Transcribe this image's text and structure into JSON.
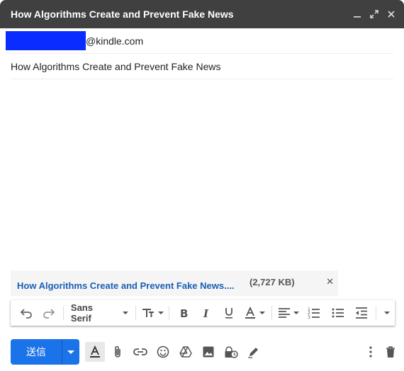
{
  "window": {
    "title": "How Algorithms Create and Prevent Fake News",
    "controls": [
      "minimize-icon",
      "expand-icon",
      "close-icon"
    ]
  },
  "recipient": {
    "domain_suffix": "@kindle.com"
  },
  "subject": "How Algorithms Create and Prevent Fake News",
  "attachment": {
    "name": "How Algorithms Create and Prevent Fake News....",
    "size": "(2,727 KB)"
  },
  "toolbar": {
    "font": "Sans Serif"
  },
  "footer": {
    "send_label": "送信"
  },
  "colors": {
    "titlebar": "#404040",
    "send": "#1a73e8",
    "link": "#1a5fb4",
    "redaction": "#0a2cff"
  }
}
